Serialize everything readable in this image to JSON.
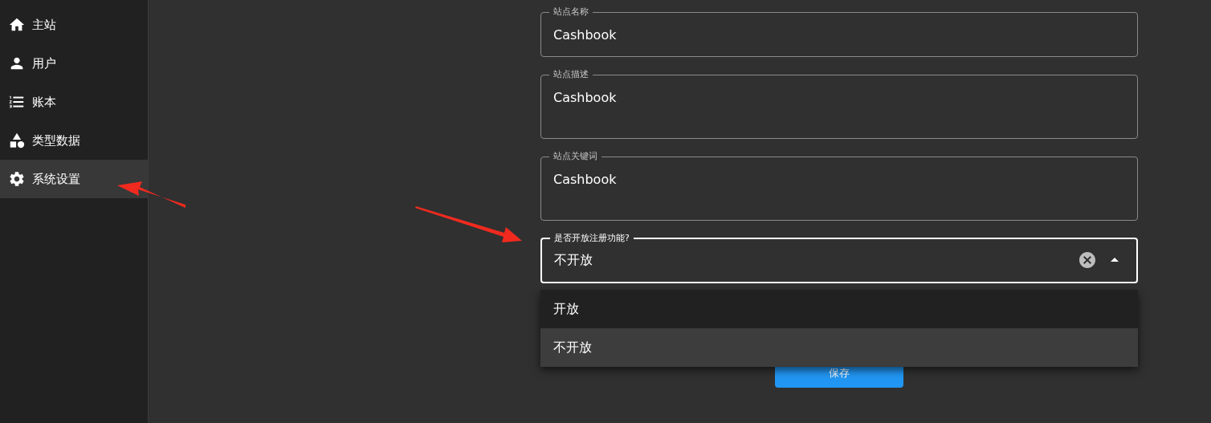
{
  "sidebar": {
    "items": [
      {
        "label": "主站",
        "selected": false
      },
      {
        "label": "用户",
        "selected": false
      },
      {
        "label": "账本",
        "selected": false
      },
      {
        "label": "类型数据",
        "selected": false
      },
      {
        "label": "系统设置",
        "selected": true
      }
    ]
  },
  "form": {
    "fields": [
      {
        "kind": "input",
        "label": "站点名称",
        "value": "Cashbook"
      },
      {
        "kind": "textarea",
        "label": "站点描述",
        "value": "Cashbook"
      },
      {
        "kind": "textarea",
        "label": "站点关键词",
        "value": "Cashbook"
      }
    ],
    "select": {
      "label": "是否开放注册功能?",
      "value": "不开放",
      "expanded": true,
      "options": [
        {
          "label": "开放",
          "selected": false
        },
        {
          "label": "不开放",
          "selected": true
        }
      ]
    },
    "save_button": "保存"
  }
}
